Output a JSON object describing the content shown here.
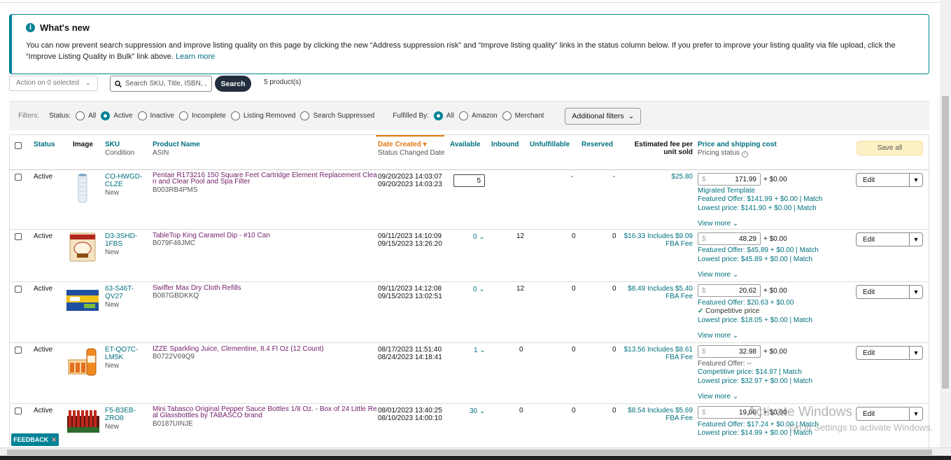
{
  "notice": {
    "title": "What's new",
    "body": "You can now prevent search suppression and improve listing quality on this page by clicking the new “Address suppression risk” and “Improve listing quality” links in the status column below. If you prefer to improve your listing quality via file upload, click the “Improve Listing Quality in Bulk” link above.",
    "learn_more": "Learn more"
  },
  "toolbar": {
    "action": "Action on 0 selected",
    "search_placeholder": "Search SKU, Title, ISBN, ,",
    "search_label": "Search",
    "count": "5 product(s)"
  },
  "filters": {
    "label": "Filters:",
    "status_label": "Status:",
    "status_options": [
      "All",
      "Active",
      "Inactive",
      "Incomplete",
      "Listing Removed",
      "Search Suppressed"
    ],
    "status_selected": "Active",
    "fulfilled_label": "Fulfilled By:",
    "fulfilled_options": [
      "All",
      "Amazon",
      "Merchant"
    ],
    "fulfilled_selected": "All",
    "additional": "Additional filters"
  },
  "headers": {
    "status": "Status",
    "image": "Image",
    "sku": "SKU",
    "condition": "Condition",
    "product_name": "Product Name",
    "asin": "ASIN",
    "date_created": "Date Created",
    "status_changed": "Status Changed Date",
    "available": "Available",
    "inbound": "Inbound",
    "unfulfillable": "Unfulfillable",
    "reserved": "Reserved",
    "fee_line1": "Estimated fee per",
    "fee_line2": "unit sold",
    "price": "Price and shipping cost",
    "pricing_status": "Pricing status",
    "save_all": "Save all"
  },
  "rows": [
    {
      "status": "Active",
      "sku1": "CO-HWGD-",
      "sku2": "CLZE",
      "condition": "New",
      "name1": "Pentair R173216 150 Square Feet Cartridge Element Replacement Clea",
      "name2": "n and Clear Pool and Spa Filter",
      "asin": "B003RB4PMS",
      "created": "09/20/2023 14:03:07",
      "changed": "09/20/2023 14:03:23",
      "available": "5",
      "inbound": "",
      "unfulfillable": "-",
      "reserved": "-",
      "fee1": "$25.80",
      "fee2": "",
      "price": "171.99",
      "shipping": "+ $0.00",
      "line1": "Migrated Template",
      "line2": "Featured Offer: $141.99 + $0.00",
      "line2_match": "Match",
      "line3": "Lowest price: $141.90 + $0.00",
      "line3_match": "Match",
      "view_more": "View more",
      "edit": "Edit"
    },
    {
      "status": "Active",
      "sku1": "D3-3SHD-",
      "sku2": "1FBS",
      "condition": "New",
      "name1": "TableTop King Caramel Dip - #10 Can",
      "name2": "",
      "asin": "B079F48JMC",
      "created": "09/11/2023 14:10:09",
      "changed": "09/15/2023 13:26:20",
      "available": "0",
      "inbound": "12",
      "unfulfillable": "0",
      "reserved": "0",
      "fee1": "$16.33 Includes $9.09",
      "fee2": "FBA Fee",
      "price": "48.29",
      "shipping": "+ $0.00",
      "line1": "Featured Offer: $45.89 + $0.00",
      "line1_match": "Match",
      "line2": "Lowest price: $45.89 + $0.00",
      "line2_match": "Match",
      "view_more": "View more",
      "edit": "Edit"
    },
    {
      "status": "Active",
      "sku1": "63-S46T-",
      "sku2": "QV27",
      "condition": "New",
      "name1": "Swiffer Max Dry Cloth Refills",
      "name2": "",
      "asin": "B087GBDKKQ",
      "created": "09/11/2023 14:12:08",
      "changed": "09/15/2023 13:02:51",
      "available": "0",
      "inbound": "12",
      "unfulfillable": "0",
      "reserved": "0",
      "fee1": "$8.49 Includes $5.40",
      "fee2": "FBA Fee",
      "price": "20.62",
      "shipping": "+ $0.00",
      "line1": "Featured Offer: $20.63 + $0.00",
      "line2": "Competitive price",
      "line3": "Lowest price: $18.05 + $0.00",
      "line3_match": "Match",
      "view_more": "View more",
      "edit": "Edit"
    },
    {
      "status": "Active",
      "sku1": "ET-QO7C-",
      "sku2": "LM5K",
      "condition": "New",
      "name1": "IZZE Sparkling Juice, Clementine, 8.4 Fl Oz (12 Count)",
      "name2": "",
      "asin": "B0722V69Q9",
      "created": "08/17/2023 11:51:40",
      "changed": "08/24/2023 14:18:41",
      "available": "1",
      "inbound": "0",
      "unfulfillable": "0",
      "reserved": "0",
      "fee1": "$13.56 Includes $8.61",
      "fee2": "FBA Fee",
      "price": "32.98",
      "shipping": "+ $0.00",
      "line1": "Featured Offer: --",
      "line2": "Competitive price: $14.97",
      "line2_match": "Match",
      "line3": "Lowest price: $32.97 + $0.00",
      "line3_match": "Match",
      "view_more": "View more",
      "edit": "Edit"
    },
    {
      "status": "Active",
      "sku1": "F5-B3EB-",
      "sku2": "ZRO8",
      "condition": "New",
      "name1": "Mini Tabasco Original Pepper Sauce Bottles 1/8 Oz. - Box of 24 Little Re",
      "name2": "al Glassbottles by TABASCO brand",
      "asin": "B0187UINJE",
      "created": "08/01/2023 13:40:25",
      "changed": "08/10/2023 14:00:10",
      "available": "30",
      "inbound": "0",
      "unfulfillable": "0",
      "reserved": "0",
      "fee1": "$8.54 Includes $5.69",
      "fee2": "FBA Fee",
      "price": "19.00",
      "shipping": "+ $0.00",
      "line1": "Featured Offer: $17.24 + $0.00",
      "line1_match": "Match",
      "line2": "Lowest price: $14.99 + $0.00",
      "line2_match": "Match",
      "edit": "Edit"
    }
  ],
  "feedback": "FEEDBACK",
  "watermark": {
    "line1": "Activate Windows",
    "line2": "Go to Settings to activate Windows."
  }
}
